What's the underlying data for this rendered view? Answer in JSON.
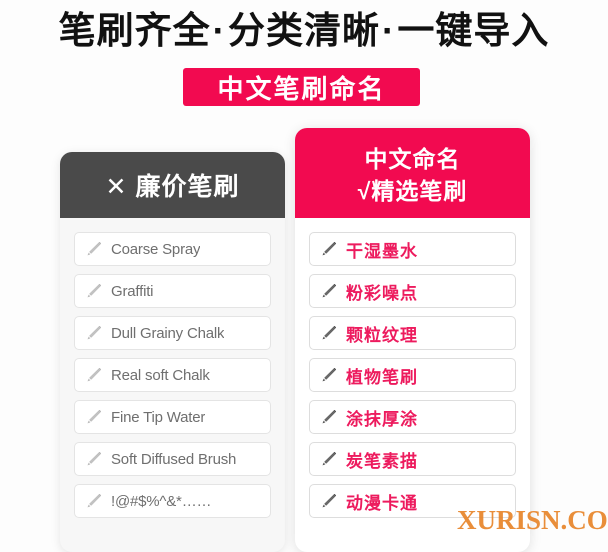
{
  "headline": {
    "part1": "笔刷齐全",
    "sep1": "·",
    "part2": "分类清晰",
    "sep2": "·",
    "part3": "一键导入"
  },
  "badge": {
    "label": "中文笔刷命名",
    "bg_color": "#F20A50",
    "text_color": "#FFFFFF"
  },
  "left_card": {
    "header": {
      "mark": "✕",
      "title": "廉价笔刷",
      "bg_color": "#4A4A4A"
    },
    "items": [
      {
        "icon": "brush-icon",
        "label": "Coarse Spray"
      },
      {
        "icon": "brush-icon",
        "label": "Graffiti"
      },
      {
        "icon": "brush-icon",
        "label": "Dull Grainy Chalk"
      },
      {
        "icon": "brush-icon",
        "label": "Real soft Chalk"
      },
      {
        "icon": "brush-icon",
        "label": "Fine Tip Water"
      },
      {
        "icon": "brush-icon",
        "label": "Soft Diffused Brush"
      },
      {
        "icon": "brush-icon",
        "label": "!@#$%^&*……"
      }
    ]
  },
  "right_card": {
    "header": {
      "line1": "中文命名",
      "mark": "√",
      "line2": "精选笔刷",
      "bg_color": "#F20A50"
    },
    "items": [
      {
        "icon": "brush-icon",
        "label": "干湿墨水"
      },
      {
        "icon": "brush-icon",
        "label": "粉彩噪点"
      },
      {
        "icon": "brush-icon",
        "label": "颗粒纹理"
      },
      {
        "icon": "brush-icon",
        "label": "植物笔刷"
      },
      {
        "icon": "brush-icon",
        "label": "涂抹厚涂"
      },
      {
        "icon": "brush-icon",
        "label": "炭笔素描"
      },
      {
        "icon": "brush-icon",
        "label": "动漫卡通"
      }
    ],
    "label_color": "#ED1B5E"
  },
  "watermark": {
    "text": "XURISN.COM",
    "color": "#E8852A"
  }
}
